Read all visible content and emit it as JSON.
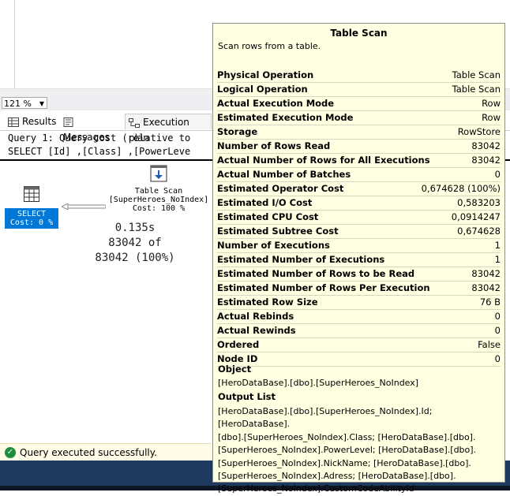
{
  "zoom": "121 %",
  "tabs": {
    "results": "Results",
    "messages": "Messages",
    "plan": "Execution plan"
  },
  "query": {
    "line1": "Query 1: Query cost (relative to",
    "line2": "SELECT [Id] ,[Class] ,[PowerLeve"
  },
  "plan": {
    "select_node": {
      "label": "SELECT",
      "cost": "Cost: 0 %"
    },
    "scan_node": {
      "label": "Table Scan",
      "table": "[SuperHeroes_NoIndex]",
      "cost": "Cost: 100 %"
    },
    "stats": {
      "time": "0.135s",
      "rows": "83042 of",
      "total": "83042 (100%)"
    }
  },
  "status": {
    "text": "Query executed successfully."
  },
  "tooltip": {
    "title": "Table Scan",
    "description": "Scan rows from a table.",
    "properties": [
      {
        "key": "Physical Operation",
        "value": "Table Scan"
      },
      {
        "key": "Logical Operation",
        "value": "Table Scan"
      },
      {
        "key": "Actual Execution Mode",
        "value": "Row"
      },
      {
        "key": "Estimated Execution Mode",
        "value": "Row"
      },
      {
        "key": "Storage",
        "value": "RowStore"
      },
      {
        "key": "Number of Rows Read",
        "value": "83042"
      },
      {
        "key": "Actual Number of Rows for All Executions",
        "value": "83042"
      },
      {
        "key": "Actual Number of Batches",
        "value": "0"
      },
      {
        "key": "Estimated Operator Cost",
        "value": "0,674628 (100%)"
      },
      {
        "key": "Estimated I/O Cost",
        "value": "0,583203"
      },
      {
        "key": "Estimated CPU Cost",
        "value": "0,0914247"
      },
      {
        "key": "Estimated Subtree Cost",
        "value": "0,674628"
      },
      {
        "key": "Number of Executions",
        "value": "1"
      },
      {
        "key": "Estimated Number of Executions",
        "value": "1"
      },
      {
        "key": "Estimated Number of Rows to be Read",
        "value": "83042"
      },
      {
        "key": "Estimated Number of Rows Per Execution",
        "value": "83042"
      },
      {
        "key": "Estimated Row Size",
        "value": "76 B"
      },
      {
        "key": "Actual Rebinds",
        "value": "0"
      },
      {
        "key": "Actual Rewinds",
        "value": "0"
      },
      {
        "key": "Ordered",
        "value": "False"
      },
      {
        "key": "Node ID",
        "value": "0"
      }
    ],
    "object_label": "Object",
    "object_value": "[HeroDataBase].[dbo].[SuperHeroes_NoIndex]",
    "output_label": "Output List",
    "output_lines": [
      "[HeroDataBase].[dbo].[SuperHeroes_NoIndex].Id; [HeroDataBase].",
      "[dbo].[SuperHeroes_NoIndex].Class; [HeroDataBase].[dbo].",
      "[SuperHeroes_NoIndex].PowerLevel; [HeroDataBase].[dbo].",
      "[SuperHeroes_NoIndex].NickName; [HeroDataBase].[dbo].",
      "[SuperHeroes_NoIndex].Adress; [HeroDataBase].[dbo].",
      "[SuperHeroes_NoIndex].CustomCodeAbilityId"
    ]
  }
}
